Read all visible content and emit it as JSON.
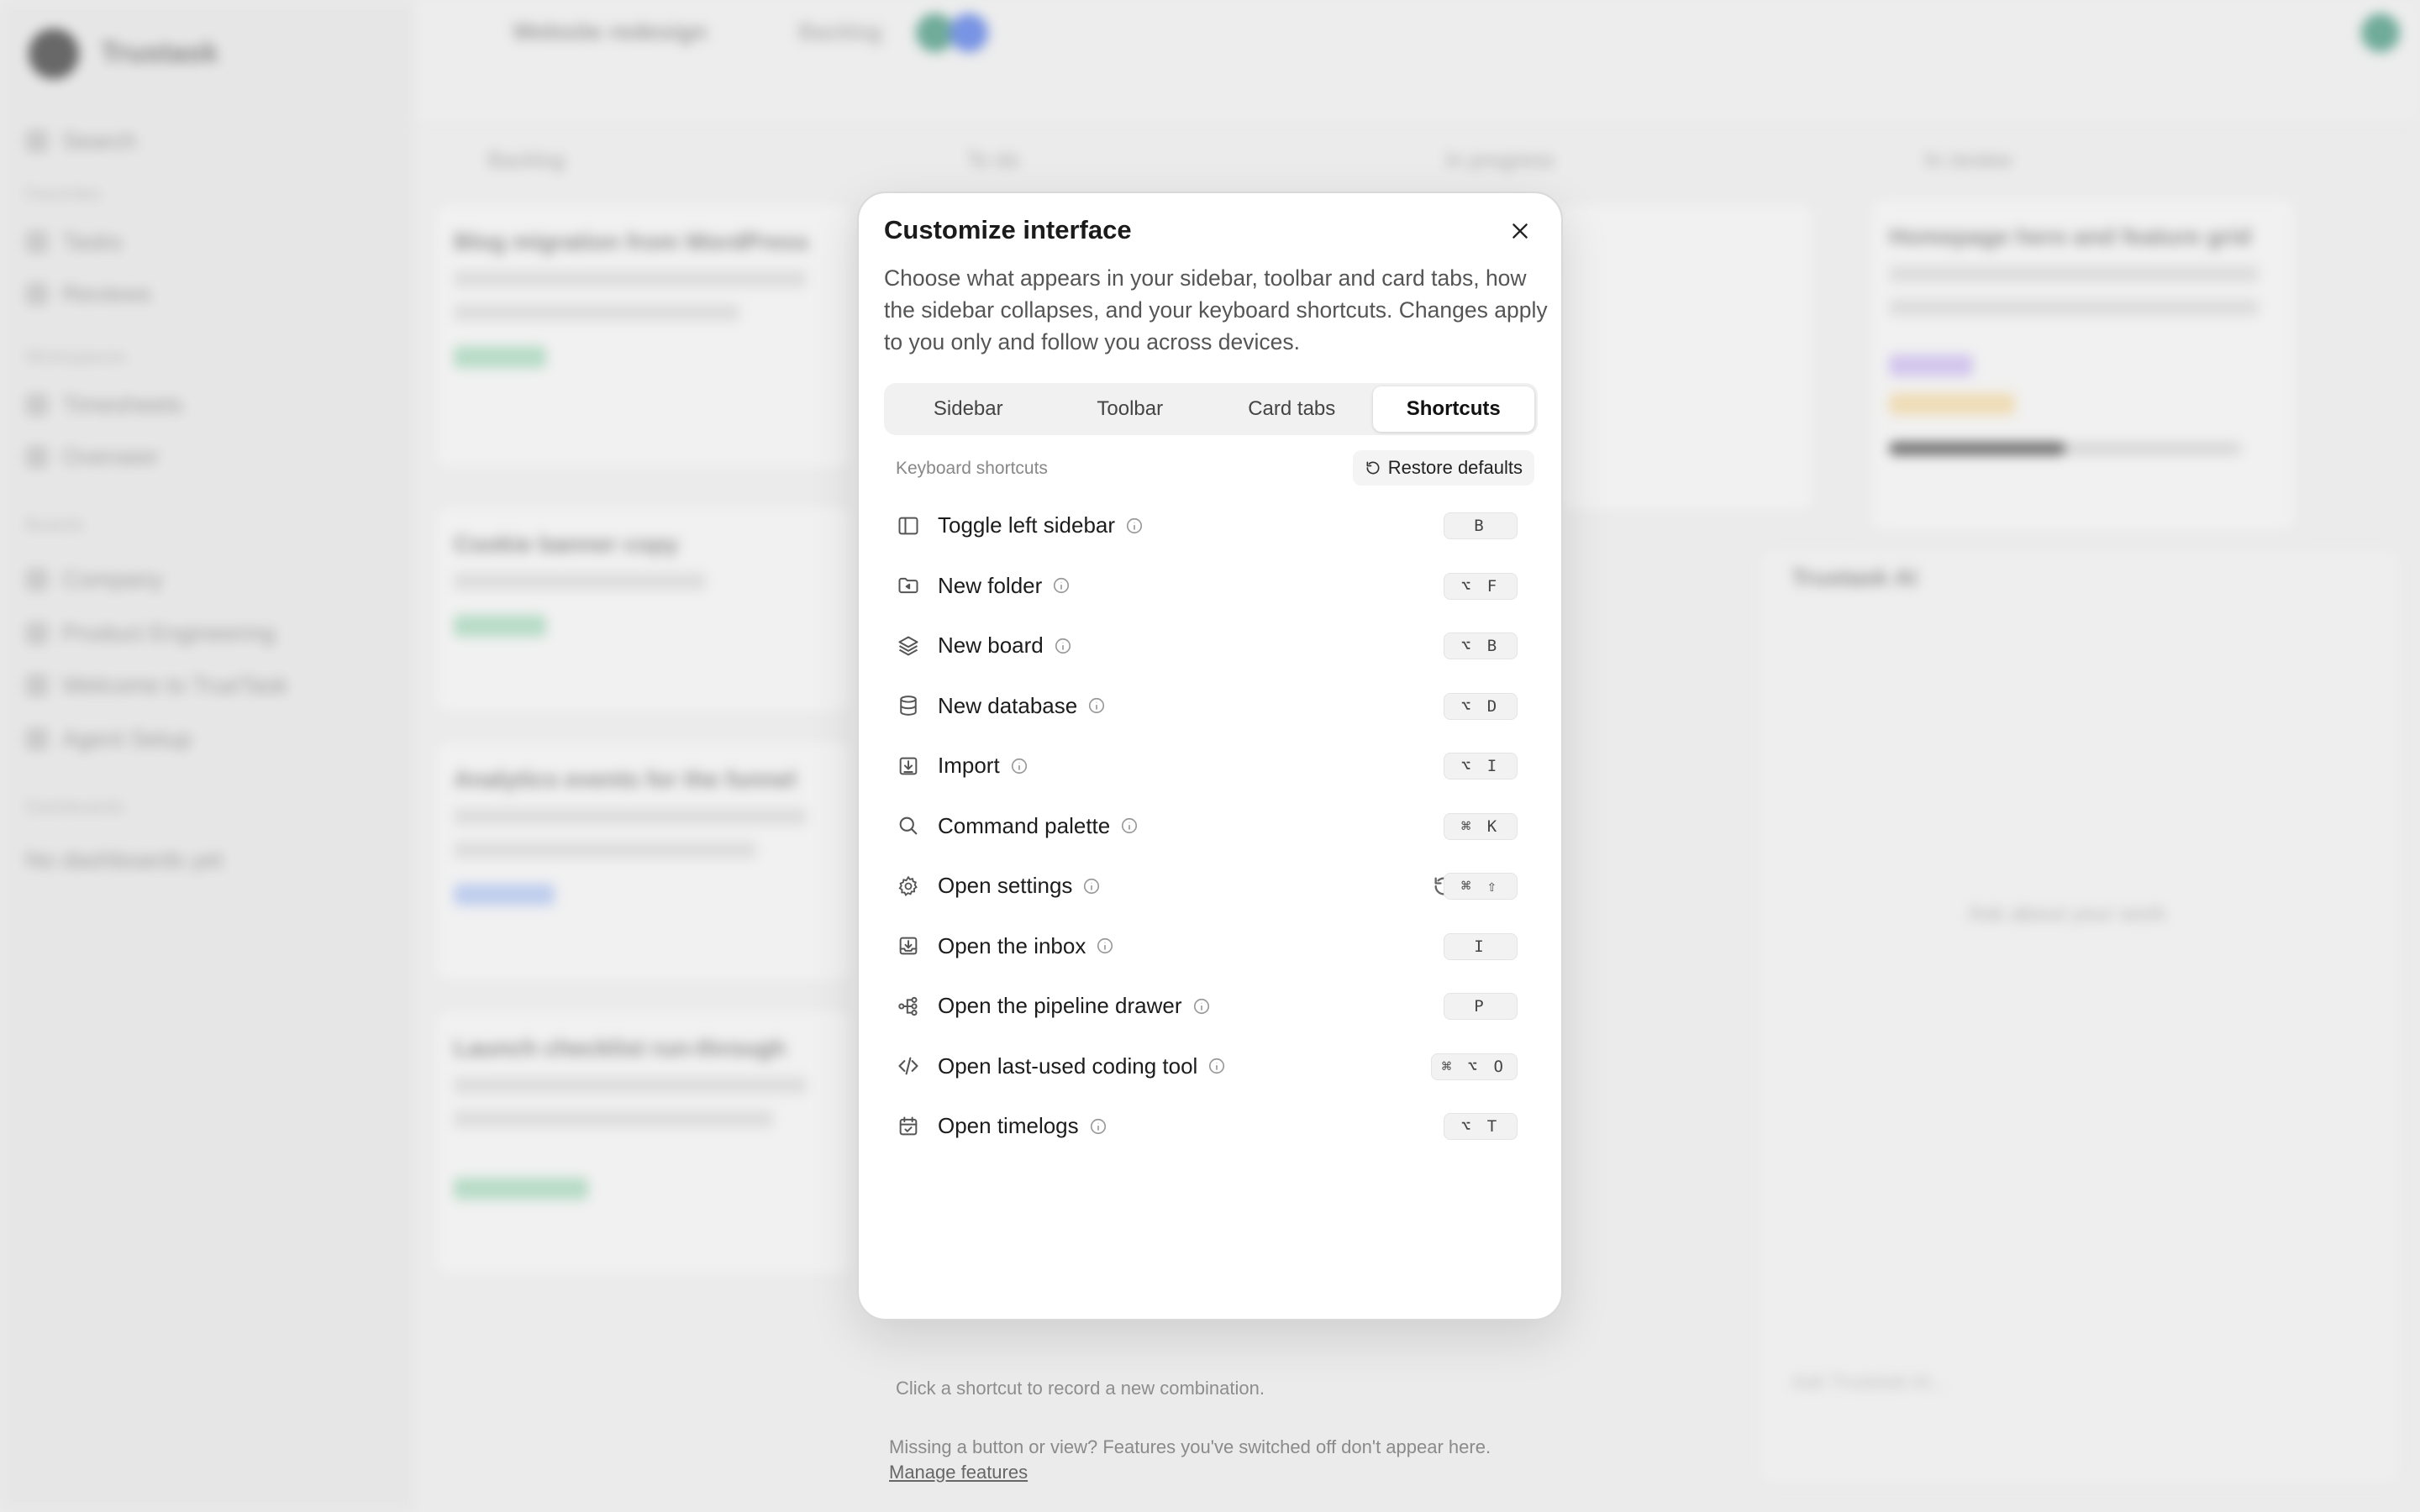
{
  "background": {
    "brand": "Trustask",
    "sidebar": {
      "items": [
        "Search",
        "Tasks",
        "Reviews",
        "Timesheets",
        "Overseer",
        "Company",
        "Product Engineering",
        "Welcome to TrueTask",
        "Agent Setup",
        "No dashboards yet"
      ],
      "headers": [
        "Favorites",
        "Workspaces",
        "Boards",
        "Dashboards"
      ]
    },
    "header": {
      "title": "Website redesign",
      "status": "Backlog"
    },
    "columns": [
      "Backlog",
      "To do",
      "In progress",
      "In review"
    ],
    "cards": [
      "Blog migration from WordPress",
      "Cookie banner copy",
      "Analytics events for the funnel",
      "Launch checklist run-through",
      "Homepage hero and feature grid"
    ],
    "ai_panel": {
      "title": "Trustask AI",
      "prompt": "Ask about your work",
      "input_placeholder": "Ask Trustask AI..."
    }
  },
  "modal": {
    "title": "Customize interface",
    "description": "Choose what appears in your sidebar, toolbar and card tabs, how the sidebar collapses, and your keyboard shortcuts. Changes apply to you only and follow you across devices.",
    "tabs": [
      {
        "label": "Sidebar",
        "active": false
      },
      {
        "label": "Toolbar",
        "active": false
      },
      {
        "label": "Card tabs",
        "active": false
      },
      {
        "label": "Shortcuts",
        "active": true
      }
    ],
    "section_label": "Keyboard shortcuts",
    "restore_label": "Restore defaults",
    "shortcuts": [
      {
        "label": "Toggle left sidebar",
        "icon": "sidebar-icon",
        "keys": "B"
      },
      {
        "label": "New folder",
        "icon": "folder-plus-icon",
        "keys": "⌥ F"
      },
      {
        "label": "New board",
        "icon": "layers-icon",
        "keys": "⌥ B"
      },
      {
        "label": "New database",
        "icon": "database-icon",
        "keys": "⌥ D"
      },
      {
        "label": "Import",
        "icon": "import-icon",
        "keys": "⌥ I"
      },
      {
        "label": "Command palette",
        "icon": "search-icon",
        "keys": "⌘ K"
      },
      {
        "label": "Open settings",
        "icon": "gear-icon",
        "keys": "⌘ ⇧",
        "modified": true
      },
      {
        "label": "Open the inbox",
        "icon": "inbox-icon",
        "keys": "I"
      },
      {
        "label": "Open the pipeline drawer",
        "icon": "pipeline-icon",
        "keys": "P"
      },
      {
        "label": "Open last-used coding tool",
        "icon": "code-icon",
        "keys": "⌘ ⌥ O"
      },
      {
        "label": "Open timelogs",
        "icon": "calendar-check-icon",
        "keys": "⌥ T"
      }
    ],
    "hint": "Click a shortcut to record a new combination.",
    "footer_text": "Missing a button or view? Features you've switched off don't appear here. ",
    "footer_link": "Manage features"
  }
}
